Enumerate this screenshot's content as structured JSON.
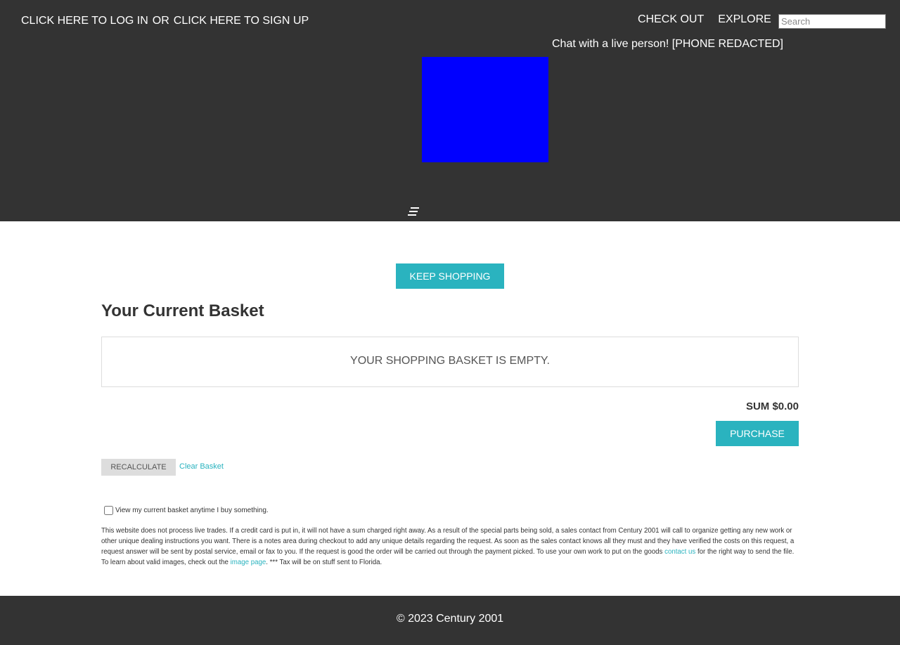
{
  "header": {
    "auth": {
      "login_link": "CLICK HERE TO LOG IN",
      "or_text": "OR",
      "signup_link": "CLICK HERE TO SIGN UP"
    },
    "nav": {
      "checkout": "CHECK OUT",
      "explore": "EXPLORE"
    },
    "search": {
      "placeholder": "Search",
      "value": ""
    },
    "chat_text": "Chat with a live person! [PHONE REDACTED]",
    "logo": {
      "color": "#0000ff"
    },
    "menu_icon": "hamburger-icon",
    "background_color": "#333333"
  },
  "basket": {
    "keep_shopping_label": "KEEP SHOPPING",
    "title": "Your Current Basket",
    "empty_message": "YOUR SHOPPING BASKET IS EMPTY.",
    "sum_text": "SUM $0.00",
    "purchase_label": "PURCHASE",
    "recalculate_label": "RECALCULATE",
    "clear_label": "Clear Basket",
    "accent_color": "#2ab3bf"
  },
  "options": {
    "view_basket_label": "View my current basket anytime I buy something.",
    "view_basket_checked": false
  },
  "notice": {
    "part1": "This website does not process live trades. If a credit card is put in, it will not have a sum charged right away. As a result of the special parts being sold, a sales contact from Century 2001 will call to organize getting any new work or other unique dealing instructions you want. There is a notes area during checkout to add any unique details regarding the request. As soon as the sales contact knows all they must and they have verified the costs on this request, a request answer will be sent by postal service, email or fax to you. If the request is good the order will be carried out through the payment picked. To use your own work to put on the goods ",
    "contact_link": "contact us",
    "part2": " for the right way to send the file. To learn about valid images, check out the ",
    "image_link": "image page",
    "part3": ". *** Tax will be on stuff sent to Florida."
  },
  "footer": {
    "copyright": "© 2023 Century 2001"
  }
}
